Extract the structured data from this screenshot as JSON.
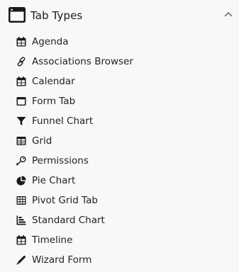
{
  "section": {
    "title": "Tab Types",
    "header_icon": "window-icon",
    "collapse_icon": "chevron-up-icon",
    "expanded": true
  },
  "items": [
    {
      "label": "Agenda",
      "icon": "calendar-icon"
    },
    {
      "label": "Associations Browser",
      "icon": "link-icon"
    },
    {
      "label": "Calendar",
      "icon": "calendar-icon"
    },
    {
      "label": "Form Tab",
      "icon": "window-icon"
    },
    {
      "label": "Funnel Chart",
      "icon": "funnel-icon"
    },
    {
      "label": "Grid",
      "icon": "table-icon"
    },
    {
      "label": "Permissions",
      "icon": "key-icon"
    },
    {
      "label": "Pie Chart",
      "icon": "pie-chart-icon"
    },
    {
      "label": "Pivot Grid Tab",
      "icon": "grid-icon"
    },
    {
      "label": "Standard Chart",
      "icon": "bar-chart-icon"
    },
    {
      "label": "Timeline",
      "icon": "calendar-icon"
    },
    {
      "label": "Wizard Form",
      "icon": "pencil-icon"
    }
  ],
  "colors": {
    "background": "#f8f8f8",
    "icon": "#1a1a1a",
    "text": "#222222"
  }
}
